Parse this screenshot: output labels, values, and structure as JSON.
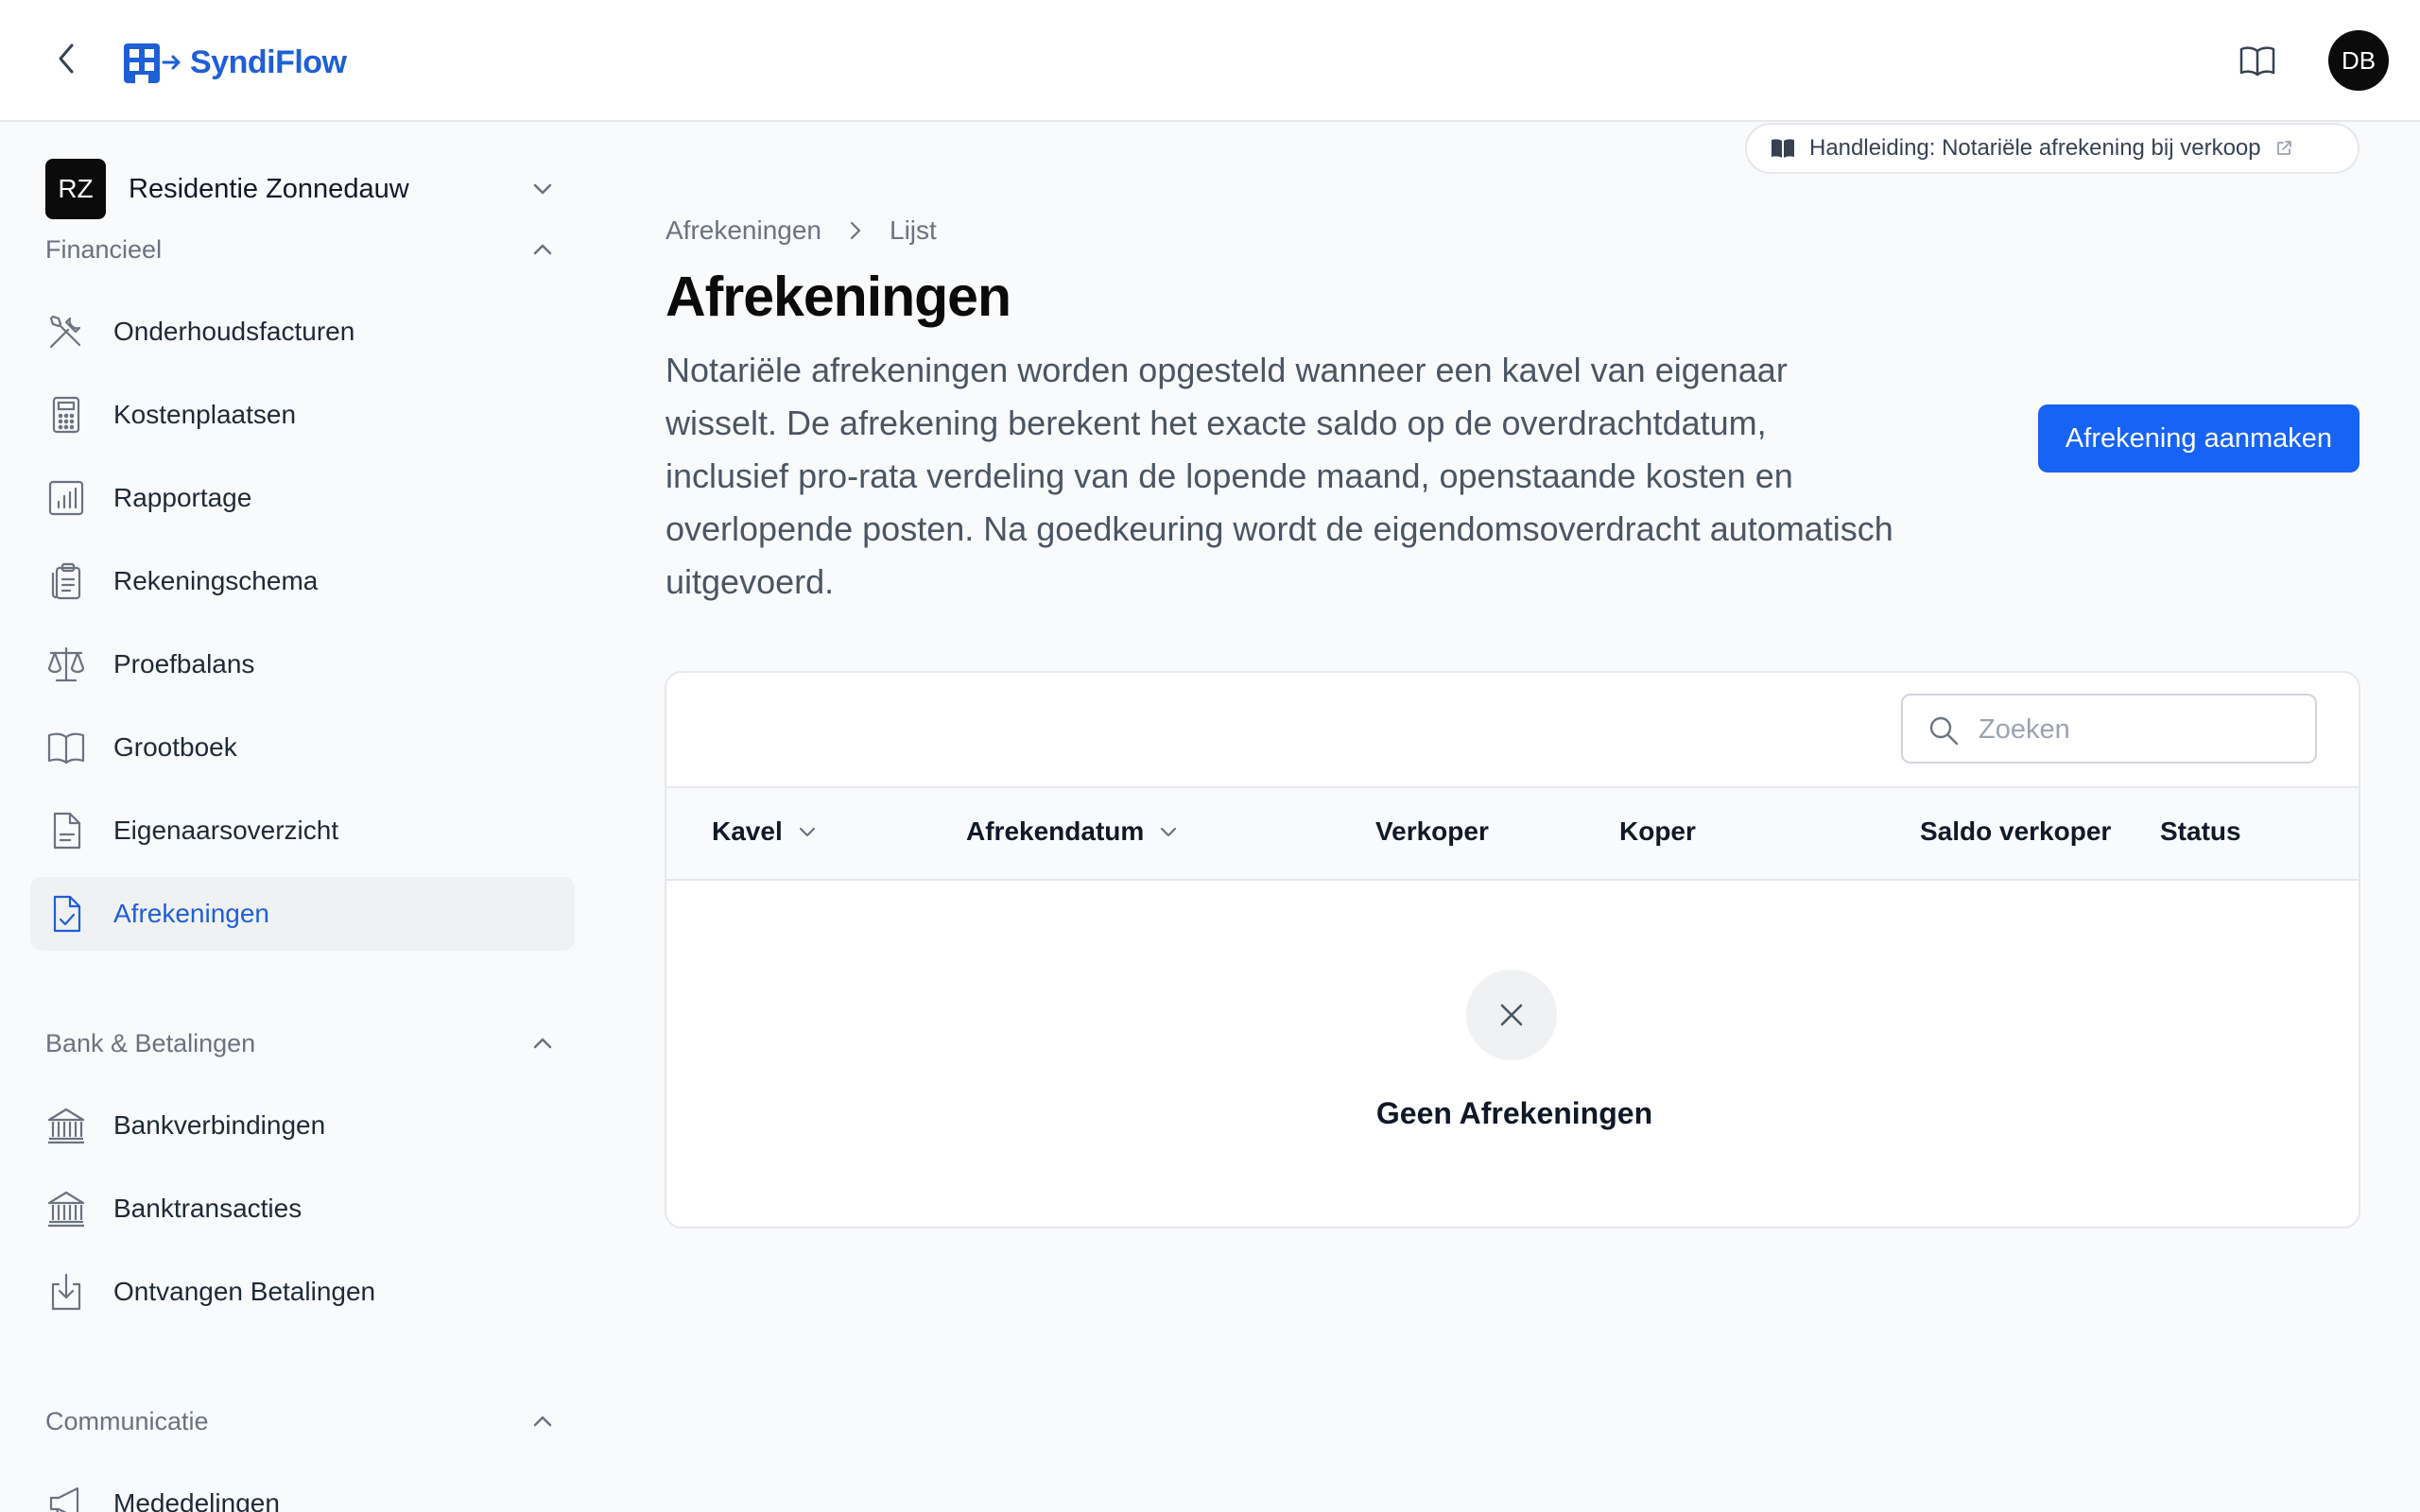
{
  "header": {
    "logo_text": "SyndiFlow",
    "avatar_initials": "DB"
  },
  "sidebar": {
    "org": {
      "badge": "RZ",
      "name": "Residentie Zonnedauw"
    },
    "sections": [
      {
        "title": "Financieel",
        "items": [
          {
            "label": "Onderhoudsfacturen",
            "icon": "tools-icon"
          },
          {
            "label": "Kostenplaatsen",
            "icon": "calculator-icon"
          },
          {
            "label": "Rapportage",
            "icon": "bar-chart-icon"
          },
          {
            "label": "Rekeningschema",
            "icon": "clipboard-list-icon"
          },
          {
            "label": "Proefbalans",
            "icon": "scale-icon"
          },
          {
            "label": "Grootboek",
            "icon": "book-open-icon"
          },
          {
            "label": "Eigenaarsoverzicht",
            "icon": "document-text-icon"
          },
          {
            "label": "Afrekeningen",
            "icon": "document-check-icon",
            "active": true
          }
        ]
      },
      {
        "title": "Bank & Betalingen",
        "items": [
          {
            "label": "Bankverbindingen",
            "icon": "bank-icon"
          },
          {
            "label": "Banktransacties",
            "icon": "bank-icon"
          },
          {
            "label": "Ontvangen Betalingen",
            "icon": "download-tray-icon"
          }
        ]
      },
      {
        "title": "Communicatie",
        "items": [
          {
            "label": "Mededelingen",
            "icon": "megaphone-icon"
          }
        ]
      }
    ]
  },
  "main": {
    "manual_link": "Handleiding: Notariële afrekening bij verkoop",
    "breadcrumb": [
      "Afrekeningen",
      "Lijst"
    ],
    "title": "Afrekeningen",
    "description": "Notariële afrekeningen worden opgesteld wanneer een kavel van eigenaar wisselt. De afrekening berekent het exacte saldo op de overdrachtdatum, inclusief pro-rata verdeling van de lopende maand, openstaande kosten en overlopende posten. Na goedkeuring wordt de eigendomsoverdracht automatisch uitgevoerd.",
    "create_button": "Afrekening aanmaken",
    "search_placeholder": "Zoeken",
    "columns": [
      "Kavel",
      "Afrekendatum",
      "Verkoper",
      "Koper",
      "Saldo verkoper",
      "Status"
    ],
    "empty_text": "Geen Afrekeningen"
  },
  "colors": {
    "accent": "#1763f5",
    "brand": "#1e5fd6",
    "active_bg": "#f0f1f3"
  }
}
